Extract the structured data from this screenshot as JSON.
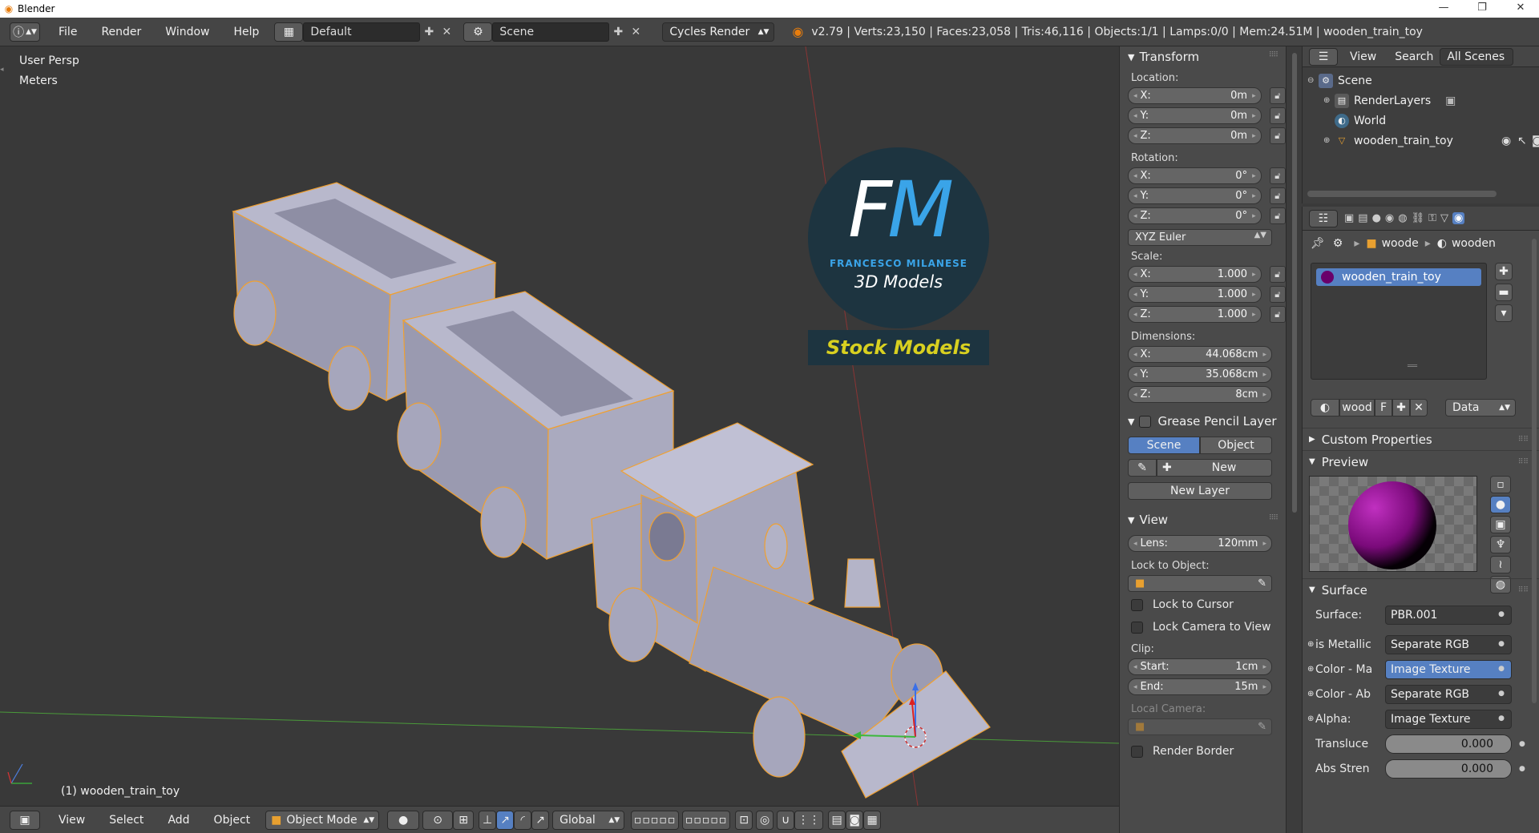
{
  "window": {
    "title": "Blender",
    "minimize": "—",
    "maximize": "❐",
    "close": "✕"
  },
  "infobar": {
    "menus": [
      "File",
      "Render",
      "Window",
      "Help"
    ],
    "screen_layout": "Default",
    "scene": "Scene",
    "engine": "Cycles Render",
    "stats": "v2.79 | Verts:23,150 | Faces:23,058 | Tris:46,116 | Objects:1/1 | Lamps:0/0 | Mem:24.51M | wooden_train_toy"
  },
  "viewport": {
    "view_name": "User Persp",
    "units": "Meters",
    "object_label": "(1) wooden_train_toy",
    "logo": {
      "initials": "FM",
      "name": "FRANCESCO MILANESE",
      "tagline": "3D Models",
      "banner": "Stock Models"
    }
  },
  "bottombar": {
    "menus": [
      "View",
      "Select",
      "Add",
      "Object"
    ],
    "mode": "Object Mode",
    "orientation": "Global"
  },
  "npanel": {
    "transform": {
      "title": "Transform",
      "location_label": "Location:",
      "location": [
        {
          "axis": "X:",
          "value": "0m"
        },
        {
          "axis": "Y:",
          "value": "0m"
        },
        {
          "axis": "Z:",
          "value": "0m"
        }
      ],
      "rotation_label": "Rotation:",
      "rotation": [
        {
          "axis": "X:",
          "value": "0°"
        },
        {
          "axis": "Y:",
          "value": "0°"
        },
        {
          "axis": "Z:",
          "value": "0°"
        }
      ],
      "rotation_mode": "XYZ Euler",
      "scale_label": "Scale:",
      "scale": [
        {
          "axis": "X:",
          "value": "1.000"
        },
        {
          "axis": "Y:",
          "value": "1.000"
        },
        {
          "axis": "Z:",
          "value": "1.000"
        }
      ],
      "dimensions_label": "Dimensions:",
      "dimensions": [
        {
          "axis": "X:",
          "value": "44.068cm"
        },
        {
          "axis": "Y:",
          "value": "35.068cm"
        },
        {
          "axis": "Z:",
          "value": "8cm"
        }
      ]
    },
    "grease_pencil": {
      "title": "Grease Pencil Layer",
      "tab_scene": "Scene",
      "tab_object": "Object",
      "new_label": "New",
      "new_layer_label": "New Layer"
    },
    "view": {
      "title": "View",
      "lens_label": "Lens:",
      "lens_value": "120mm",
      "lock_to_object": "Lock to Object:",
      "lock_to_cursor": "Lock to Cursor",
      "lock_camera": "Lock Camera to View",
      "clip_label": "Clip:",
      "clip_start_label": "Start:",
      "clip_start": "1cm",
      "clip_end_label": "End:",
      "clip_end": "15m",
      "local_camera": "Local Camera:",
      "render_border": "Render Border"
    }
  },
  "outliner": {
    "menus": [
      "View",
      "Search"
    ],
    "filter": "All Scenes",
    "items": [
      {
        "label": "Scene",
        "level": 0
      },
      {
        "label": "RenderLayers",
        "level": 1
      },
      {
        "label": "World",
        "level": 1
      },
      {
        "label": "wooden_train_toy",
        "level": 1
      }
    ]
  },
  "properties": {
    "breadcrumb": [
      "woode",
      "wooden"
    ],
    "material_slot": "wooden_train_toy",
    "material_name": "wood",
    "fake_user": "F",
    "link": "Data",
    "sections": {
      "custom": "Custom Properties",
      "preview": "Preview",
      "surface": "Surface"
    },
    "surface": [
      {
        "key": "Surface:",
        "value": "PBR.001",
        "style": "dark"
      },
      {
        "key": "is Metallic",
        "value": "Separate RGB",
        "style": "dark"
      },
      {
        "key": "Color - Ma",
        "value": "Image Texture",
        "style": "blue"
      },
      {
        "key": "Color - Ab",
        "value": "Separate RGB",
        "style": "dark"
      },
      {
        "key": "Alpha:",
        "value": "Image Texture",
        "style": "dark"
      },
      {
        "key": "Transluce",
        "value": "0.000",
        "style": "slider"
      },
      {
        "key": "Abs Stren",
        "value": "0.000",
        "style": "slider"
      }
    ]
  },
  "colors": {
    "accent_blue": "#5680c2",
    "selection_orange": "#f0a030",
    "banner_yellow": "#d8d020",
    "logo_blue": "#3aa4e8"
  }
}
